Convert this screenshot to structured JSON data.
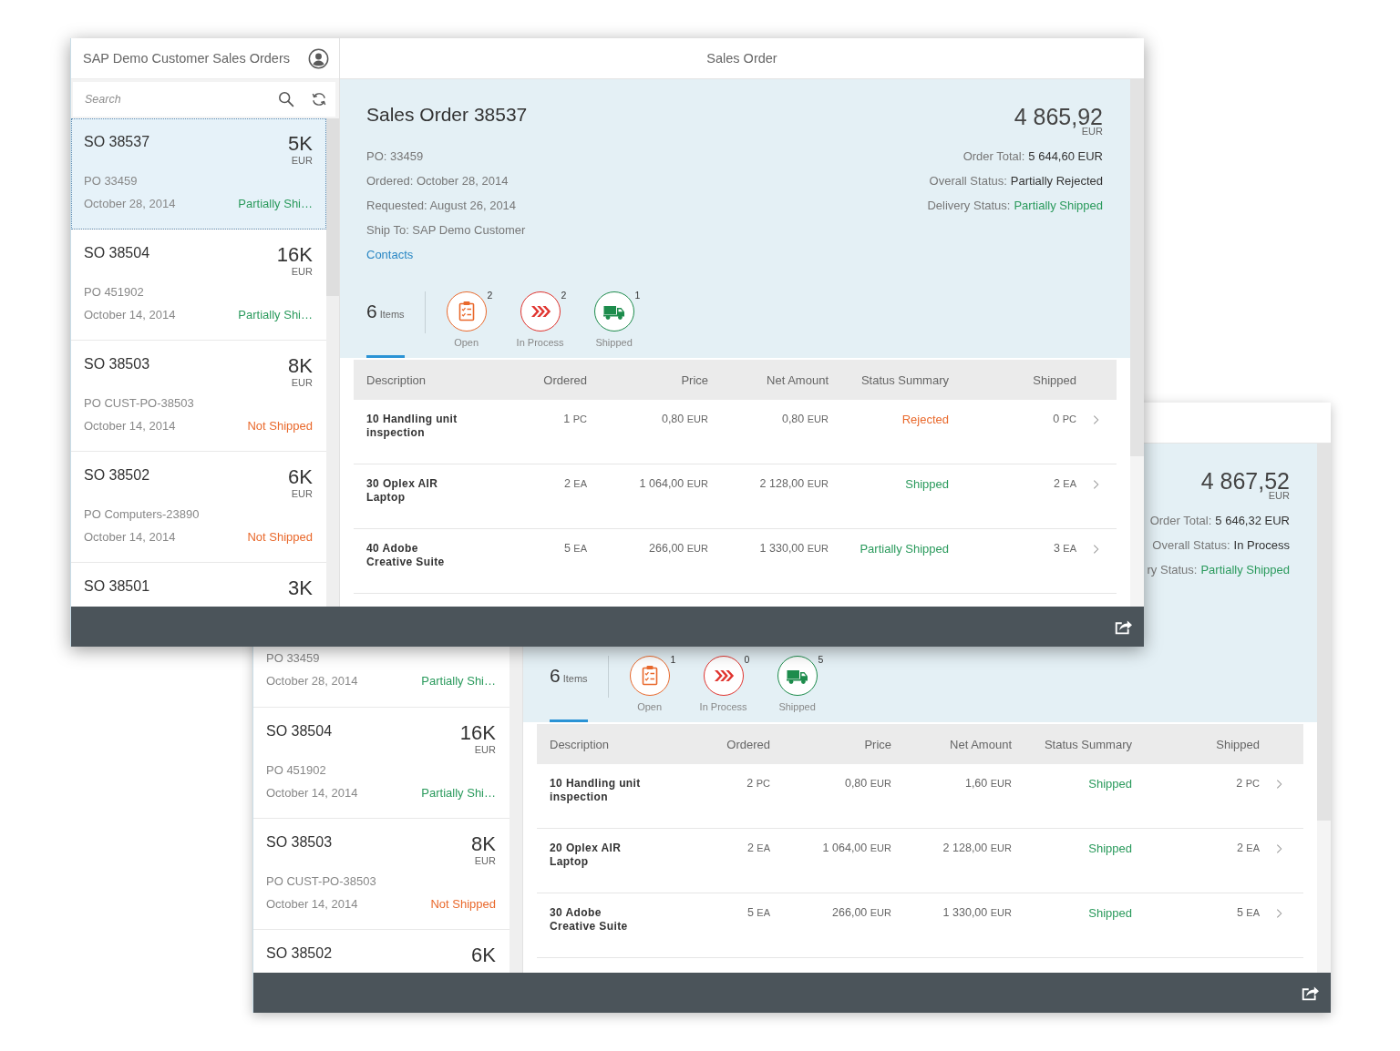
{
  "windows": [
    {
      "active": true,
      "master": {
        "title": "SAP Demo Customer Sales Orders",
        "search": {
          "placeholder": "Search"
        },
        "items": [
          {
            "title": "SO 38537",
            "number": "5K",
            "unit": "EUR",
            "po": "PO 33459",
            "date": "October 28, 2014",
            "status": "Partially Shi…",
            "color": "#2a9a5c",
            "selected": true
          },
          {
            "title": "SO 38504",
            "number": "16K",
            "unit": "EUR",
            "po": "PO 451902",
            "date": "October 14, 2014",
            "status": "Partially Shi…",
            "color": "#2a9a5c",
            "selected": false
          },
          {
            "title": "SO 38503",
            "number": "8K",
            "unit": "EUR",
            "po": "PO CUST-PO-38503",
            "date": "October 14, 2014",
            "status": "Not Shipped",
            "color": "#e9692c",
            "selected": false
          },
          {
            "title": "SO 38502",
            "number": "6K",
            "unit": "EUR",
            "po": "PO Computers-23890",
            "date": "October 14, 2014",
            "status": "Not Shipped",
            "color": "#e9692c",
            "selected": false
          },
          {
            "title": "SO 38501",
            "number": "3K",
            "selected": false
          }
        ]
      },
      "detail": {
        "title": "Sales Order",
        "header": {
          "title": "Sales Order 38537",
          "attributes": [
            "PO: 33459",
            "Ordered: October 28, 2014",
            "Requested: August 26, 2014",
            "Ship To: SAP Demo Customer"
          ],
          "link": "Contacts",
          "number": "4 865,92",
          "unit": "EUR",
          "statuses": [
            {
              "label": "Order Total:",
              "value": "5 644,60 EUR",
              "color": "#333333"
            },
            {
              "label": "Overall Status:",
              "value": "Partially Rejected",
              "color": "#333333"
            },
            {
              "label": "Delivery Status:",
              "value": "Partially Shipped",
              "color": "#2a9a5c"
            }
          ]
        },
        "tabs": [
          {
            "kind": "count",
            "count": "6",
            "label": "Items",
            "selected": true
          },
          {
            "kind": "open",
            "count": "2",
            "label": "Open",
            "color": "#e9692c",
            "selected": false
          },
          {
            "kind": "progress",
            "count": "2",
            "label": "In Process",
            "color": "#e0342f",
            "selected": false
          },
          {
            "kind": "shipped",
            "count": "1",
            "label": "Shipped",
            "color": "#1d8c4c",
            "selected": false
          }
        ],
        "table": {
          "columns": [
            "Description",
            "Ordered",
            "Price",
            "Net Amount",
            "Status Summary",
            "Shipped"
          ],
          "rows": [
            {
              "description": "10 Handling unit inspection",
              "ordered": {
                "number": "1",
                "unit": "PC"
              },
              "price": {
                "number": "0,80",
                "unit": "EUR"
              },
              "net_amount": {
                "number": "0,80",
                "unit": "EUR"
              },
              "status": "Rejected",
              "color": "#e9692c",
              "shipped": {
                "number": "0",
                "unit": "PC"
              }
            },
            {
              "description": "30 Oplex AIR Laptop",
              "ordered": {
                "number": "2",
                "unit": "EA"
              },
              "price": {
                "number": "1 064,00",
                "unit": "EUR"
              },
              "net_amount": {
                "number": "2 128,00",
                "unit": "EUR"
              },
              "status": "Shipped",
              "color": "#2a9a5c",
              "shipped": {
                "number": "2",
                "unit": "EA"
              }
            },
            {
              "description": "40 Adobe Creative Suite",
              "ordered": {
                "number": "5",
                "unit": "EA"
              },
              "price": {
                "number": "266,00",
                "unit": "EUR"
              },
              "net_amount": {
                "number": "1 330,00",
                "unit": "EUR"
              },
              "status": "Partially Shipped",
              "color": "#2a9a5c",
              "shipped": {
                "number": "3",
                "unit": "EA"
              }
            }
          ]
        }
      }
    },
    {
      "active": false,
      "master": {
        "items": [
          {
            "po": "PO 33459",
            "date": "October 28, 2014",
            "status": "Partially Shi…",
            "color": "#2a9a5c",
            "selected": false
          },
          {
            "title": "SO 38504",
            "number": "16K",
            "unit": "EUR",
            "po": "PO 451902",
            "date": "October 14, 2014",
            "status": "Partially Shi…",
            "color": "#2a9a5c",
            "selected": false
          },
          {
            "title": "SO 38503",
            "number": "8K",
            "unit": "EUR",
            "po": "PO CUST-PO-38503",
            "date": "October 14, 2014",
            "status": "Not Shipped",
            "color": "#e9692c",
            "selected": false
          },
          {
            "title": "SO 38502",
            "number": "6K",
            "selected": false
          }
        ]
      },
      "detail": {
        "header": {
          "number": "4 867,52",
          "unit": "EUR",
          "statuses": [
            {
              "label": "Order Total:",
              "value": "5 646,32 EUR",
              "color": "#333333"
            },
            {
              "label": "Overall Status:",
              "value": "In Process",
              "color": "#333333"
            },
            {
              "label": "ry Status:",
              "value": "Partially Shipped",
              "color": "#2a9a5c"
            }
          ]
        },
        "tabs": [
          {
            "kind": "count",
            "count": "6",
            "label": "Items",
            "selected": true
          },
          {
            "kind": "open",
            "count": "1",
            "label": "Open",
            "color": "#e9692c",
            "selected": false
          },
          {
            "kind": "progress",
            "count": "0",
            "label": "In Process",
            "color": "#e0342f",
            "selected": false
          },
          {
            "kind": "shipped",
            "count": "5",
            "label": "Shipped",
            "color": "#1d8c4c",
            "selected": false
          }
        ],
        "table": {
          "columns": [
            "Description",
            "Ordered",
            "Price",
            "Net Amount",
            "Status Summary",
            "Shipped"
          ],
          "rows": [
            {
              "description": "10 Handling unit inspection",
              "ordered": {
                "number": "2",
                "unit": "PC"
              },
              "price": {
                "number": "0,80",
                "unit": "EUR"
              },
              "net_amount": {
                "number": "1,60",
                "unit": "EUR"
              },
              "status": "Shipped",
              "color": "#2a9a5c",
              "shipped": {
                "number": "2",
                "unit": "PC"
              }
            },
            {
              "description": "20 Oplex AIR Laptop",
              "ordered": {
                "number": "2",
                "unit": "EA"
              },
              "price": {
                "number": "1 064,00",
                "unit": "EUR"
              },
              "net_amount": {
                "number": "2 128,00",
                "unit": "EUR"
              },
              "status": "Shipped",
              "color": "#2a9a5c",
              "shipped": {
                "number": "2",
                "unit": "EA"
              }
            },
            {
              "description": "30 Adobe Creative Suite",
              "ordered": {
                "number": "5",
                "unit": "EA"
              },
              "price": {
                "number": "266,00",
                "unit": "EUR"
              },
              "net_amount": {
                "number": "1 330,00",
                "unit": "EUR"
              },
              "status": "Shipped",
              "color": "#2a9a5c",
              "shipped": {
                "number": "5",
                "unit": "EA"
              }
            }
          ]
        }
      }
    }
  ]
}
